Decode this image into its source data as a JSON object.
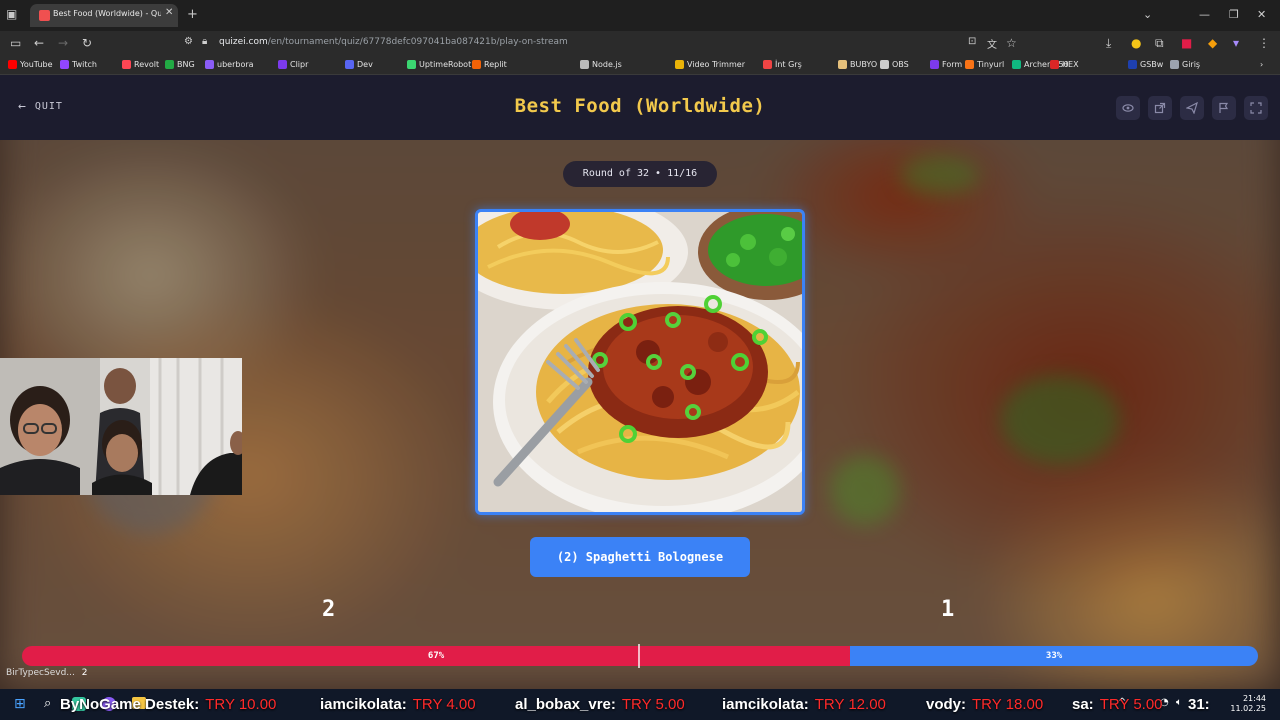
{
  "browser": {
    "tab_title": "Best Food (Worldwide) - Quizei",
    "url_domain": "quizei.com",
    "url_path": "/en/tournament/quiz/67778defc097041ba087421b/play-on-stream",
    "bookmarks": [
      {
        "label": "YouTube",
        "color": "#ff0000"
      },
      {
        "label": "Twitch",
        "color": "#9146ff"
      },
      {
        "label": "Revolt",
        "color": "#ff4654"
      },
      {
        "label": "BNG",
        "color": "#22aa44"
      },
      {
        "label": "uberbora",
        "color": "#8a5cf6"
      },
      {
        "label": "Clipr",
        "color": "#7c3aed"
      },
      {
        "label": "Dev",
        "color": "#5865f2"
      },
      {
        "label": "UptimeRobot",
        "color": "#3bd671"
      },
      {
        "label": "Replit",
        "color": "#f26207"
      },
      {
        "label": "Node.js",
        "color": "#bbbbbb"
      },
      {
        "label": "Video Trimmer",
        "color": "#eab308"
      },
      {
        "label": "İnt Grş",
        "color": "#ef4444"
      },
      {
        "label": "BUBYO",
        "color": "#e5c07b"
      },
      {
        "label": "OBS",
        "color": "#cccccc"
      },
      {
        "label": "Form",
        "color": "#7c3aed"
      },
      {
        "label": "Tinyurl",
        "color": "#f97316"
      },
      {
        "label": "Archer C50",
        "color": "#10b981"
      },
      {
        "label": "HEX",
        "color": "#dc2626"
      },
      {
        "label": "GSBw",
        "color": "#1e40af"
      },
      {
        "label": "Giriş",
        "color": "#9ca3af"
      }
    ]
  },
  "header": {
    "quit_label": "QUIT",
    "title": "Best Food (Worldwide)"
  },
  "round": {
    "label": "Round of 32 • 11/16"
  },
  "choice": {
    "label": "(2) Spaghetti Bolognese"
  },
  "scores": {
    "left": "2",
    "right": "1"
  },
  "votes": {
    "left_pct_label": "67%",
    "right_pct_label": "33%",
    "left_fraction": 0.67
  },
  "chat": {
    "user": "BirTypecSevd...",
    "value": "2"
  },
  "ticker": [
    {
      "name": "ByNoGame Destek:",
      "amount": "TRY 10.00"
    },
    {
      "name": "iamcikolata:",
      "amount": "TRY 4.00"
    },
    {
      "name": "al_bobax_vre:",
      "amount": "TRY 5.00"
    },
    {
      "name": "iamcikolata:",
      "amount": "TRY 12.00"
    },
    {
      "name": "vody:",
      "amount": "TRY 18.00"
    },
    {
      "name": "sa:",
      "amount": "TRY 5.00"
    },
    {
      "name": "31:",
      "amount": ""
    }
  ],
  "clock": {
    "time": "21:44",
    "date": "11.02.25"
  },
  "colors": {
    "accent_blue": "#3b82f6",
    "accent_red": "#e11d48",
    "title_yellow": "#f2c94c"
  }
}
